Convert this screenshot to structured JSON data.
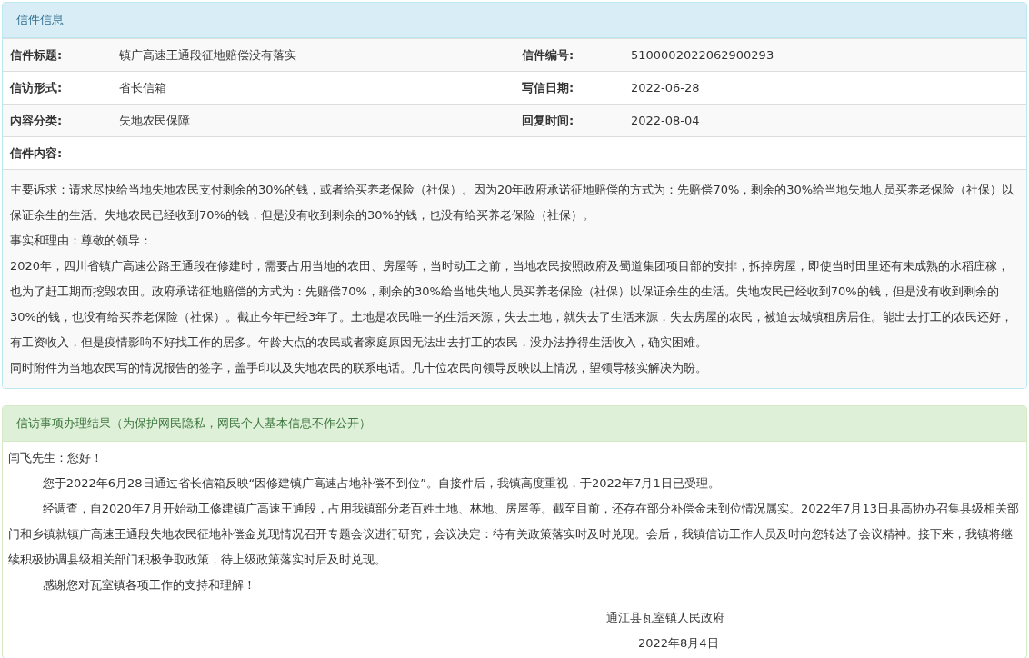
{
  "letter_panel": {
    "title": "信件信息",
    "fields": [
      {
        "label": "信件标题:",
        "value": "镇广高速王通段征地赔偿没有落实"
      },
      {
        "label": "信件编号:",
        "value": "5100002022062900293"
      },
      {
        "label": "信访形式:",
        "value": "省长信箱"
      },
      {
        "label": "写信日期:",
        "value": "2022-06-28"
      },
      {
        "label": "内容分类:",
        "value": "失地农民保障"
      },
      {
        "label": "回复时间:",
        "value": "2022-08-04"
      }
    ],
    "content_label": "信件内容:",
    "content_paragraphs": [
      "主要诉求：请求尽快给当地失地农民支付剩余的30%的钱，或者给买养老保险（社保）。因为20年政府承诺征地赔偿的方式为：先赔偿70%，剩余的30%给当地失地人员买养老保险（社保）以保证余生的生活。失地农民已经收到70%的钱，但是没有收到剩余的30%的钱，也没有给买养老保险（社保）。",
      "事实和理由：尊敬的领导：",
      "2020年，四川省镇广高速公路王通段在修建时，需要占用当地的农田、房屋等，当时动工之前，当地农民按照政府及蜀道集团项目部的安排，拆掉房屋，即使当时田里还有未成熟的水稻庄稼，也为了赶工期而挖毁农田。政府承诺征地赔偿的方式为：先赔偿70%，剩余的30%给当地失地人员买养老保险（社保）以保证余生的生活。失地农民已经收到70%的钱，但是没有收到剩余的30%的钱，也没有给买养老保险（社保）。截止今年已经3年了。土地是农民唯一的生活来源，失去土地，就失去了生活来源，失去房屋的农民，被迫去城镇租房居住。能出去打工的农民还好，有工资收入，但是疫情影响不好找工作的居多。年龄大点的农民或者家庭原因无法出去打工的农民，没办法挣得生活收入，确实困难。",
      "同时附件为当地农民写的情况报告的签字，盖手印以及失地农民的联系电话。几十位农民向领导反映以上情况，望领导核实解决为盼。"
    ]
  },
  "reply_panel": {
    "title": "信访事项办理结果（为保护网民隐私，网民个人基本信息不作公开）",
    "greeting": "闫飞先生：您好！",
    "paragraphs": [
      "您于2022年6月28日通过省长信箱反映“因修建镇广高速占地补偿不到位”。自接件后，我镇高度重视，于2022年7月1日已受理。",
      "经调查，自2020年7月开始动工修建镇广高速王通段，占用我镇部分老百姓土地、林地、房屋等。截至目前，还存在部分补偿金未到位情况属实。2022年7月13日县高协办召集县级相关部门和乡镇就镇广高速王通段失地农民征地补偿金兑现情况召开专题会议进行研究，会议决定：待有关政策落实时及时兑现。会后，我镇信访工作人员及时向您转达了会议精神。接下来，我镇将继续积极协调县级相关部门积极争取政策，待上级政策落实时后及时兑现。",
      "感谢您对瓦室镇各项工作的支持和理解！"
    ],
    "signature": "通江县瓦室镇人民政府",
    "date": "2022年8月4日"
  }
}
